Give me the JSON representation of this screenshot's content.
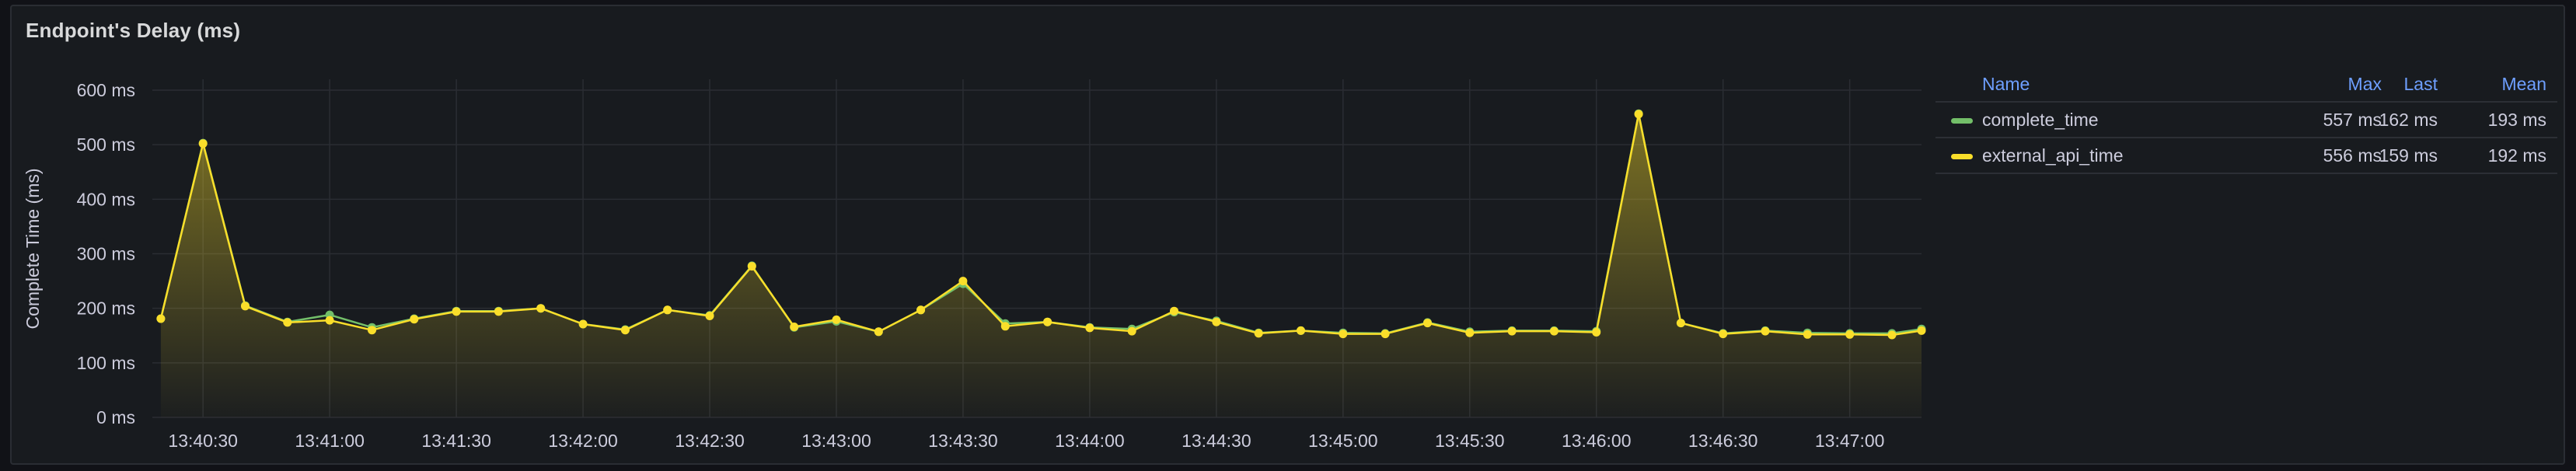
{
  "panel": {
    "title": "Endpoint's Delay (ms)"
  },
  "legend": {
    "headers": {
      "name": "Name",
      "max": "Max",
      "last": "Last",
      "mean": "Mean"
    },
    "rows": [
      {
        "name": "complete_time",
        "max": "557 ms",
        "last": "162 ms",
        "mean": "193 ms",
        "color": "#73bf69"
      },
      {
        "name": "external_api_time",
        "max": "556 ms",
        "last": "159 ms",
        "mean": "192 ms",
        "color": "#fade2a"
      }
    ]
  },
  "chart_data": {
    "type": "area",
    "ylabel": "Complete Time (ms)",
    "xlabel": "",
    "ylim": [
      0,
      600
    ],
    "yticks": [
      0,
      100,
      200,
      300,
      400,
      500,
      600
    ],
    "ytick_labels": [
      "0 ms",
      "100 ms",
      "200 ms",
      "300 ms",
      "400 ms",
      "500 ms",
      "600 ms"
    ],
    "xlim": [
      "13:40:18",
      "13:47:17"
    ],
    "xticks": [
      "13:40:30",
      "13:41:00",
      "13:41:30",
      "13:42:00",
      "13:42:30",
      "13:43:00",
      "13:43:30",
      "13:44:00",
      "13:44:30",
      "13:45:00",
      "13:45:30",
      "13:46:00",
      "13:46:30",
      "13:47:00"
    ],
    "grid": true,
    "legend_position": "right",
    "x": [
      "13:40:20",
      "13:40:30",
      "13:40:40",
      "13:40:50",
      "13:41:00",
      "13:41:10",
      "13:41:20",
      "13:41:30",
      "13:41:40",
      "13:41:50",
      "13:42:00",
      "13:42:10",
      "13:42:20",
      "13:42:30",
      "13:42:40",
      "13:42:50",
      "13:43:00",
      "13:43:10",
      "13:43:20",
      "13:43:30",
      "13:43:40",
      "13:43:50",
      "13:44:00",
      "13:44:10",
      "13:44:20",
      "13:44:30",
      "13:44:40",
      "13:44:50",
      "13:45:00",
      "13:45:10",
      "13:45:20",
      "13:45:30",
      "13:45:40",
      "13:45:50",
      "13:46:00",
      "13:46:10",
      "13:46:20",
      "13:46:30",
      "13:46:40",
      "13:46:50",
      "13:47:00",
      "13:47:10",
      "13:47:17"
    ],
    "series": [
      {
        "name": "complete_time",
        "color": "#73bf69",
        "values": [
          181,
          503,
          205,
          175,
          188,
          165,
          181,
          195,
          195,
          200,
          171,
          161,
          197,
          187,
          278,
          165,
          176,
          157,
          197,
          245,
          172,
          175,
          165,
          162,
          193,
          177,
          155,
          159,
          155,
          154,
          174,
          157,
          159,
          159,
          158,
          557,
          173,
          154,
          159,
          155,
          154,
          154,
          162
        ]
      },
      {
        "name": "external_api_time",
        "color": "#fade2a",
        "values": [
          181,
          502,
          204,
          174,
          178,
          160,
          180,
          194,
          194,
          200,
          171,
          160,
          197,
          186,
          277,
          166,
          179,
          157,
          197,
          250,
          167,
          175,
          164,
          158,
          195,
          175,
          154,
          159,
          153,
          153,
          173,
          155,
          158,
          158,
          156,
          556,
          173,
          153,
          158,
          152,
          152,
          151,
          159
        ]
      }
    ]
  }
}
